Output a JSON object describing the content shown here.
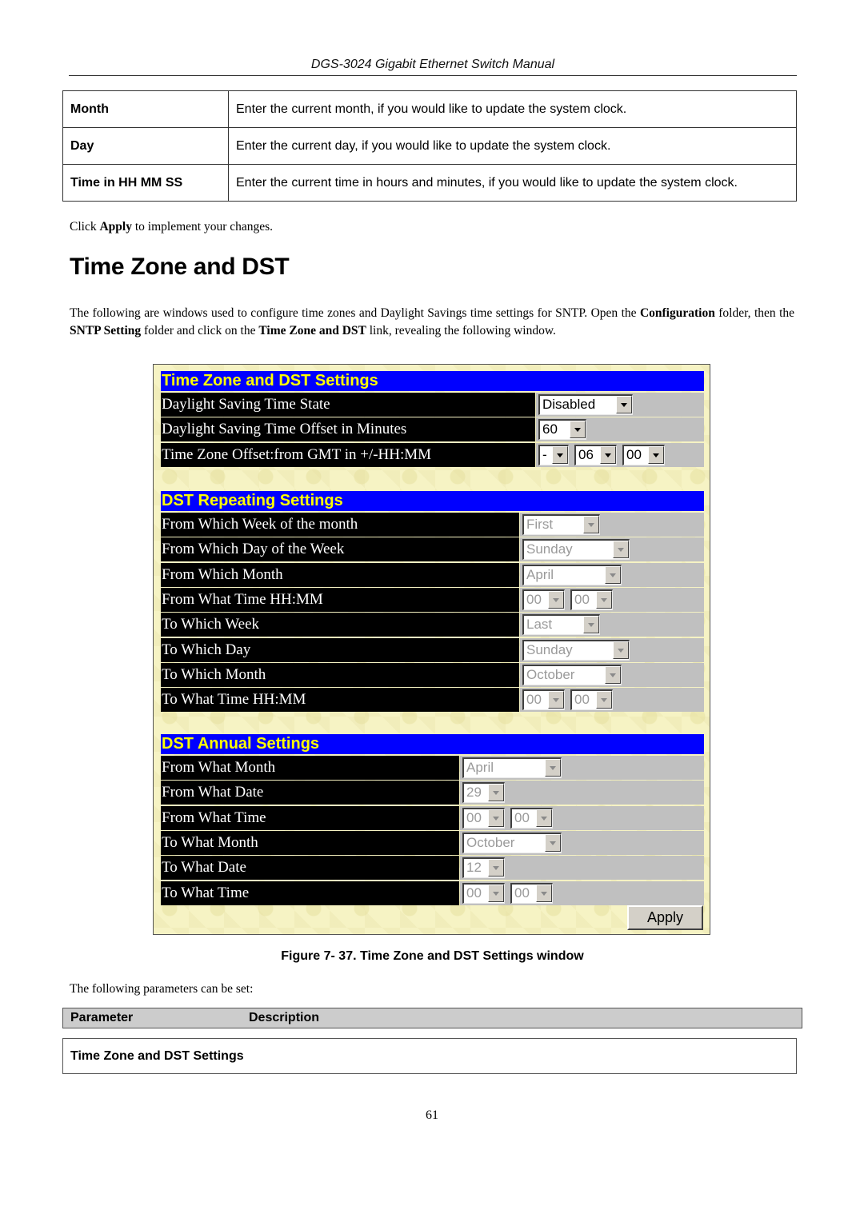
{
  "running_header": "DGS-3024 Gigabit Ethernet Switch Manual",
  "top_table": [
    {
      "parameter": "Month",
      "description": "Enter the current month, if you would like to update the system clock."
    },
    {
      "parameter": "Day",
      "description": "Enter the current day, if you would like to update the system clock."
    },
    {
      "parameter": "Time in HH MM SS",
      "description": "Enter the current time in hours and minutes, if you would like to update the system clock."
    }
  ],
  "click_apply": {
    "pre": "Click ",
    "bold": "Apply",
    "post": " to implement your changes."
  },
  "section_title": "Time Zone and DST",
  "intro": {
    "t1": "The following are windows used to configure time zones and Daylight Savings time settings for SNTP. Open the ",
    "b1": "Configuration",
    "t2": " folder, then the ",
    "b2": "SNTP Setting",
    "t3": " folder and click on the ",
    "b3": "Time Zone and DST",
    "t4": " link, revealing the following window."
  },
  "window": {
    "tz_section": {
      "title": "Time Zone and DST Settings",
      "rows": [
        {
          "label": "Daylight Saving Time State",
          "selects": [
            {
              "value": "Disabled",
              "disabled": false
            }
          ]
        },
        {
          "label": "Daylight Saving Time Offset in Minutes",
          "selects": [
            {
              "value": "60",
              "disabled": false
            }
          ]
        },
        {
          "label": "Time Zone Offset:from GMT in +/-HH:MM",
          "selects": [
            {
              "value": "-",
              "disabled": false
            },
            {
              "value": "06",
              "disabled": false
            },
            {
              "value": "00",
              "disabled": false
            }
          ]
        }
      ]
    },
    "repeating_section": {
      "title": "DST Repeating Settings",
      "rows": [
        {
          "label": "From Which Week of the month",
          "selects": [
            {
              "value": "First",
              "disabled": true
            }
          ]
        },
        {
          "label": "From Which Day of the Week",
          "selects": [
            {
              "value": "Sunday",
              "disabled": true
            }
          ]
        },
        {
          "label": "From Which Month",
          "selects": [
            {
              "value": "April",
              "disabled": true
            }
          ]
        },
        {
          "label": "From What Time HH:MM",
          "selects": [
            {
              "value": "00",
              "disabled": true
            },
            {
              "value": "00",
              "disabled": true
            }
          ]
        },
        {
          "label": "To Which Week",
          "selects": [
            {
              "value": "Last",
              "disabled": true
            }
          ]
        },
        {
          "label": "To Which Day",
          "selects": [
            {
              "value": "Sunday",
              "disabled": true
            }
          ]
        },
        {
          "label": "To Which Month",
          "selects": [
            {
              "value": "October",
              "disabled": true
            }
          ]
        },
        {
          "label": "To What Time HH:MM",
          "selects": [
            {
              "value": "00",
              "disabled": true
            },
            {
              "value": "00",
              "disabled": true
            }
          ]
        }
      ]
    },
    "annual_section": {
      "title": "DST Annual Settings",
      "rows": [
        {
          "label": "From What Month",
          "selects": [
            {
              "value": "April",
              "disabled": true
            }
          ]
        },
        {
          "label": "From What Date",
          "selects": [
            {
              "value": "29",
              "disabled": true
            }
          ]
        },
        {
          "label": "From What Time",
          "selects": [
            {
              "value": "00",
              "disabled": true
            },
            {
              "value": "00",
              "disabled": true
            }
          ]
        },
        {
          "label": "To What Month",
          "selects": [
            {
              "value": "October",
              "disabled": true
            }
          ]
        },
        {
          "label": "To What Date",
          "selects": [
            {
              "value": "12",
              "disabled": true
            }
          ]
        },
        {
          "label": "To What Time",
          "selects": [
            {
              "value": "00",
              "disabled": true
            },
            {
              "value": "00",
              "disabled": true
            }
          ]
        }
      ]
    },
    "apply_label": "Apply",
    "colors": {
      "title_bg": "#0000ff",
      "title_text": "#ffff00",
      "label_bg": "#000000",
      "value_bg": "#c0c0c0",
      "panel_bg": "#f6f3c4"
    }
  },
  "figure_caption": "Figure 7- 37. Time Zone and DST Settings window",
  "following_text": "The following parameters can be set:",
  "param_table": {
    "header_parameter": "Parameter",
    "header_description": "Description",
    "section_row": "Time Zone and DST Settings"
  },
  "page_number": "61"
}
